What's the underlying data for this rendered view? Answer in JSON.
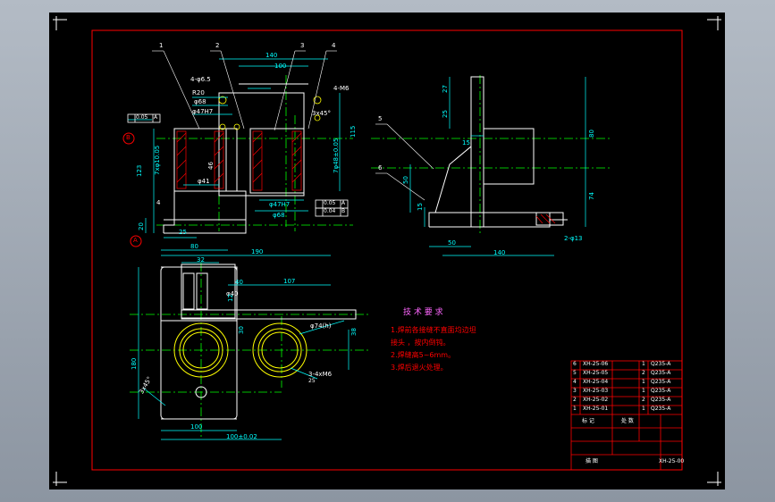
{
  "colors": {
    "background": "#000000",
    "frame": "#ff0000",
    "geometry": "#ffffff",
    "dimension": "#00ffff",
    "centerline": "#00ff00",
    "hatch": "#ff0000",
    "notes": "#ff0000",
    "note_title": "#ff66ff"
  },
  "balloons": [
    "1",
    "2",
    "3",
    "4",
    "5",
    "6"
  ],
  "datums": {
    "a": "A",
    "b": "B"
  },
  "front_view": {
    "dims_top": [
      "140",
      "100"
    ],
    "hole_note": "4-φ6.5",
    "r20": "R20",
    "phi68": "φ68",
    "phi47h7": "φ47H7",
    "thread_note": "4-M6",
    "chamfer": "3x45°",
    "tol_a": "0.05",
    "tol_a_ref": "A",
    "height_123": "123",
    "height_20": "20",
    "width_25": "25",
    "hole_7": "7xφ10.05",
    "dim_46": "46",
    "dim_41": "φ41",
    "dim_4": "4",
    "bore_right": "7φ48±0.05",
    "dim_115": "115",
    "dim_phi47h7_b": "φ47H7",
    "dim_phi68_b": "φ68",
    "tol_c": "0.05",
    "tol_c_ref": "A",
    "tol_d": "0.04",
    "tol_d_ref": "B"
  },
  "side_view": {
    "dim_27": "27",
    "dim_25": "25",
    "dim_15": "15",
    "dim_80": "80",
    "dim_74": "74",
    "dim_50": "50",
    "dim_15b": "15",
    "dim_50b": "50",
    "dim_140": "140",
    "hole": "2-φ13"
  },
  "top_view": {
    "dim_80": "80",
    "dim_190": "190",
    "dim_32": "32",
    "dim_40": "40",
    "dim_107": "107",
    "dim_phi40": "φ40",
    "dim_12": "12",
    "dim_30": "30",
    "dim_180": "180",
    "dim_phi74": "φ74(h)",
    "dim_38": "38",
    "thread": "3-4xM6",
    "dim_25": "25",
    "chamfer": "3x45°",
    "dim_100": "100",
    "dim_100b": "100±0.02"
  },
  "notes": {
    "title": "技 术 要 求",
    "lines": [
      "1.焊前各接缝不直面均边坦",
      "接头 ，按内倒钝。",
      "2.焊缝高5~6mm。",
      "3.焊后退火处理。"
    ]
  },
  "title_block": {
    "rows": [
      [
        "6",
        "XH-25-06",
        "",
        "1",
        "Q235-A"
      ],
      [
        "5",
        "XH-25-05",
        "",
        "2",
        "Q235-A"
      ],
      [
        "4",
        "XH-25-04",
        "",
        "1",
        "Q235-A"
      ],
      [
        "3",
        "XH-25-03",
        "",
        "1",
        "Q235-A"
      ],
      [
        "2",
        "XH-25-02",
        "",
        "2",
        "Q235-A"
      ],
      [
        "1",
        "XH-25-01",
        "",
        "1",
        "Q235-A"
      ]
    ],
    "label_left": "标 记",
    "label_mid": "处 数",
    "drawing_no": "XH-25-00",
    "footer": "描 图"
  }
}
